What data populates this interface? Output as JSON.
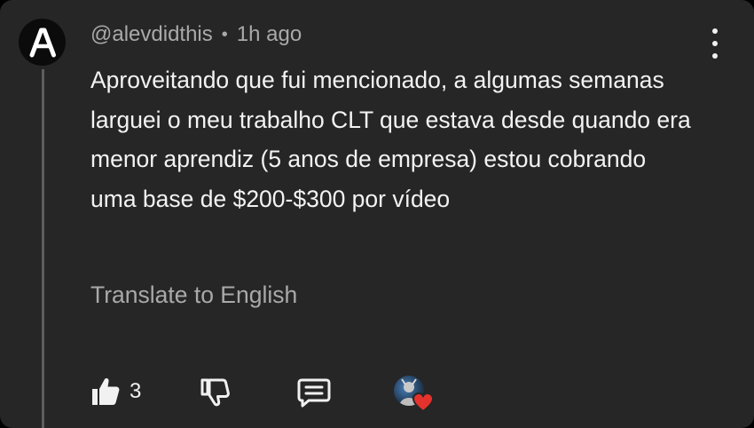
{
  "comment": {
    "avatar_letter": "A",
    "username": "@alevdidthis",
    "separator": "•",
    "time": "1h ago",
    "text": "Aproveitando que fui mencionado, a algumas semanas larguei o meu trabalho CLT que estava desde quando era menor aprendiz (5 anos de empresa) estou cobrando uma base de $200-$300 por vídeo",
    "translate_label": "Translate to English",
    "like_count": "3"
  },
  "icons": {
    "more": "more-vertical-icon",
    "like": "thumbs-up-icon",
    "dislike": "thumbs-down-icon",
    "reply": "reply-comment-icon",
    "creator_heart": "heart-icon"
  },
  "colors": {
    "background": "#262626",
    "text_primary": "#f1f1f1",
    "text_secondary": "#a9a9a9",
    "thread_line": "#5e5e5e",
    "heart": "#e5322d"
  }
}
